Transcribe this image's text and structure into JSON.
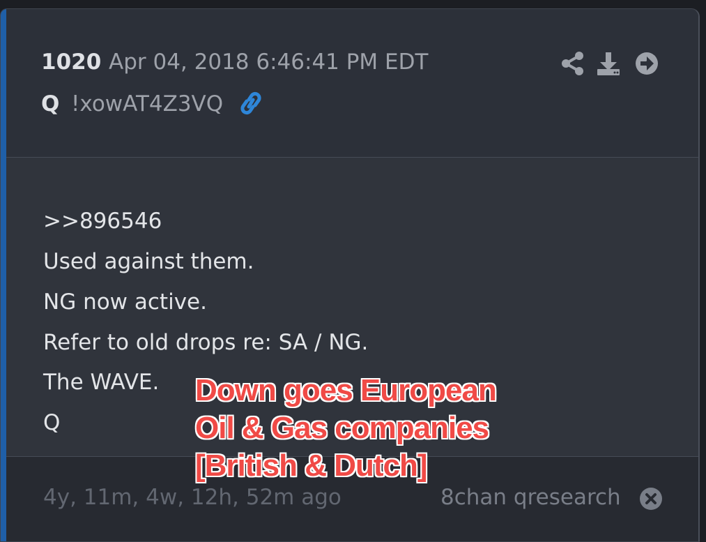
{
  "post": {
    "number": "1020",
    "timestamp": "Apr 04, 2018 6:46:41 PM EDT",
    "author": "Q",
    "tripcode": "!xowAT4Z3VQ"
  },
  "icons": {
    "link": "link-icon",
    "share": "share-icon",
    "download": "download-icon",
    "goto": "arrow-circle-right-icon",
    "close": "close-circle-icon"
  },
  "body": {
    "lines": [
      ">>896546",
      "Used against them.",
      "NG now active.",
      "Refer to old drops re: SA / NG.",
      "The WAVE.",
      "Q"
    ]
  },
  "overlay": {
    "lines": [
      "Down goes European",
      "Oil & Gas companies",
      "[British & Dutch]"
    ]
  },
  "footer": {
    "age": "4y, 11m, 4w, 12h, 52m ago",
    "source": "8chan qresearch"
  },
  "colors": {
    "accent": "#1f5fa8",
    "link": "#2e86d9",
    "overlay_text": "#f04a46"
  }
}
